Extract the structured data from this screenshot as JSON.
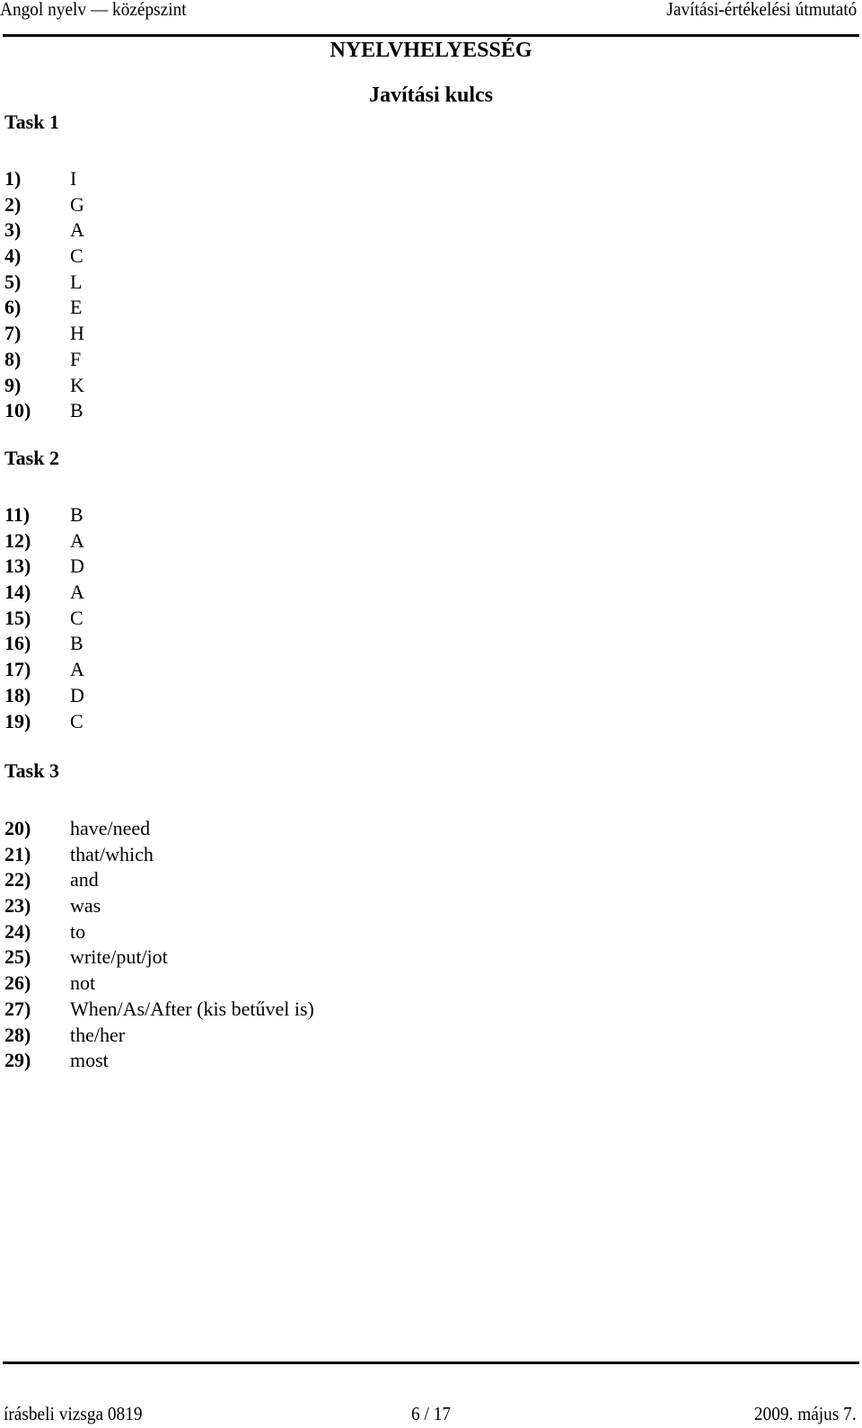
{
  "header": {
    "left": "Angol nyelv — középszint",
    "right": "Javítási-értékelési útmutató"
  },
  "titles": {
    "section": "NYELVHELYESSÉG",
    "subtitle": "Javítási kulcs"
  },
  "tasks": [
    {
      "heading": "Task 1",
      "answers": [
        {
          "num": "1)",
          "answer": "I"
        },
        {
          "num": "2)",
          "answer": "G"
        },
        {
          "num": "3)",
          "answer": "A"
        },
        {
          "num": "4)",
          "answer": "C"
        },
        {
          "num": "5)",
          "answer": "L"
        },
        {
          "num": "6)",
          "answer": "E"
        },
        {
          "num": "7)",
          "answer": "H"
        },
        {
          "num": "8)",
          "answer": "F"
        },
        {
          "num": "9)",
          "answer": "K"
        },
        {
          "num": "10)",
          "answer": "B"
        }
      ]
    },
    {
      "heading": "Task 2",
      "answers": [
        {
          "num": "11)",
          "answer": "B"
        },
        {
          "num": "12)",
          "answer": "A"
        },
        {
          "num": "13)",
          "answer": "D"
        },
        {
          "num": "14)",
          "answer": "A"
        },
        {
          "num": "15)",
          "answer": "C"
        },
        {
          "num": "16)",
          "answer": "B"
        },
        {
          "num": "17)",
          "answer": "A"
        },
        {
          "num": "18)",
          "answer": "D"
        },
        {
          "num": "19)",
          "answer": "C"
        }
      ]
    },
    {
      "heading": "Task 3",
      "answers": [
        {
          "num": "20)",
          "answer": "have/need"
        },
        {
          "num": "21)",
          "answer": "that/which"
        },
        {
          "num": "22)",
          "answer": "and"
        },
        {
          "num": "23)",
          "answer": "was"
        },
        {
          "num": "24)",
          "answer": "to"
        },
        {
          "num": "25)",
          "answer": "write/put/jot"
        },
        {
          "num": "26)",
          "answer": "not"
        },
        {
          "num": "27)",
          "answer": "When/As/After (kis betűvel is)"
        },
        {
          "num": "28)",
          "answer": "the/her"
        },
        {
          "num": "29)",
          "answer": "most"
        }
      ]
    }
  ],
  "footer": {
    "left": "írásbeli vizsga 0819",
    "center": "6 / 17",
    "right": "2009. május 7."
  }
}
